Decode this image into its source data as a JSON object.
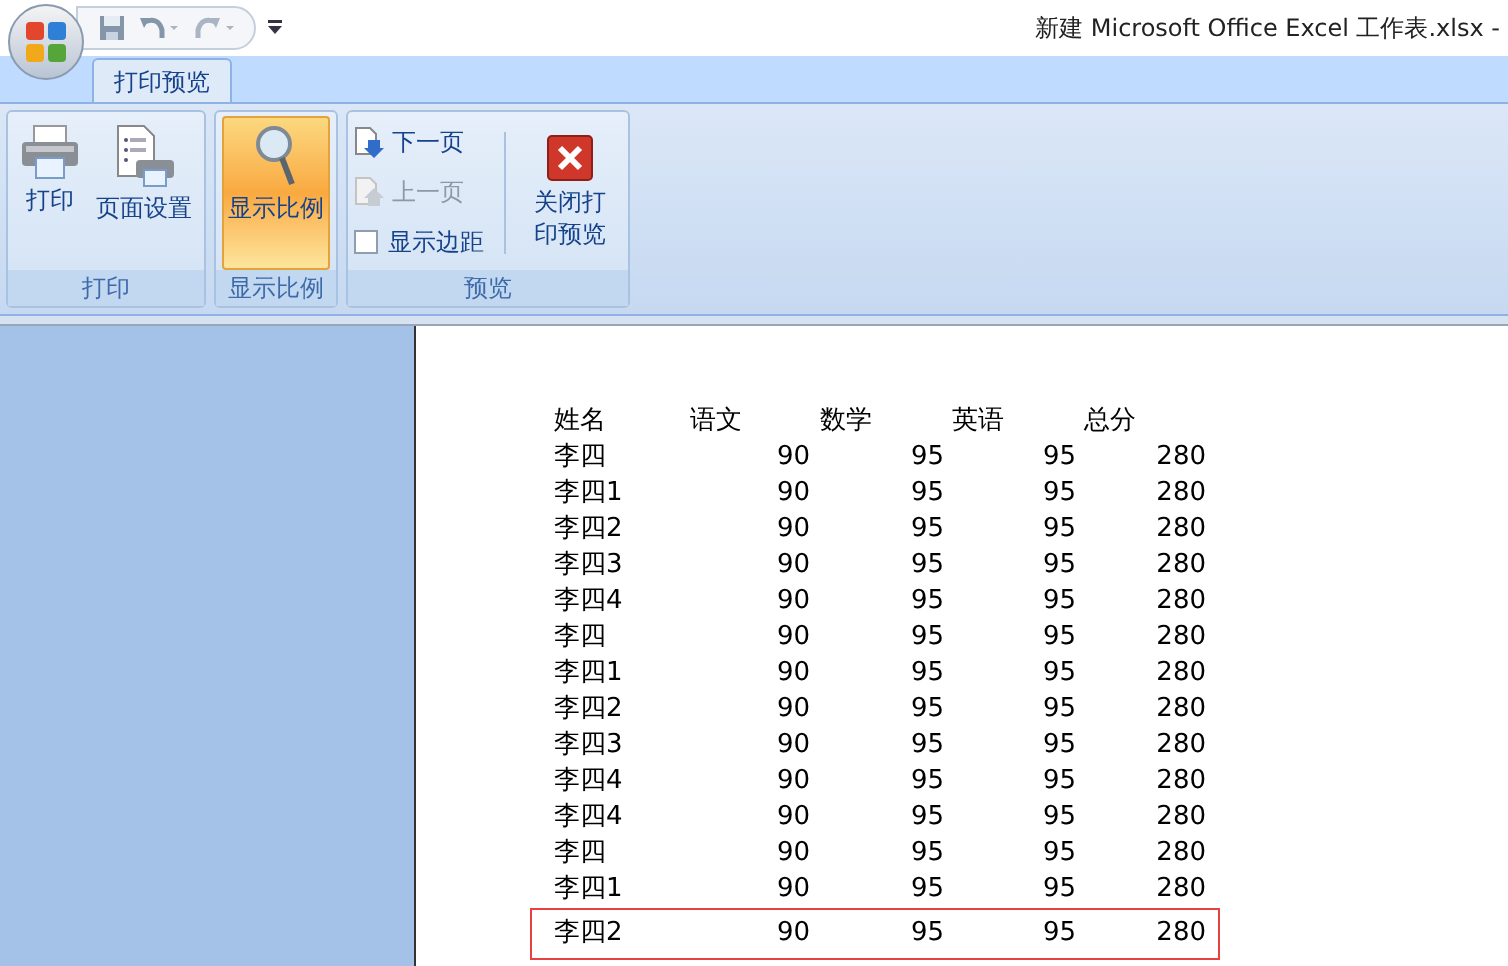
{
  "window": {
    "title": "新建 Microsoft Office Excel 工作表.xlsx -"
  },
  "tabs": [
    {
      "label": "打印预览",
      "selected": true
    }
  ],
  "ribbon": {
    "groups": [
      {
        "label": "打印",
        "items": [
          {
            "kind": "large",
            "label": "打印",
            "selected": false
          },
          {
            "kind": "large",
            "label": "页面设置",
            "selected": false
          }
        ]
      },
      {
        "label": "显示比例",
        "items": [
          {
            "kind": "large",
            "label": "显示比例",
            "selected": true
          }
        ]
      },
      {
        "label": "预览",
        "items": [
          {
            "kind": "small",
            "label": "下一页",
            "disabled": false
          },
          {
            "kind": "small",
            "label": "上一页",
            "disabled": true
          },
          {
            "kind": "checkbox",
            "label": "显示边距",
            "checked": false
          },
          {
            "kind": "large",
            "label": "关闭打印预览",
            "selected": false
          }
        ]
      }
    ]
  },
  "sheet": {
    "columns": [
      "姓名",
      "语文",
      "数学",
      "英语",
      "总分"
    ],
    "rows": [
      {
        "cells": [
          "李四",
          "90",
          "95",
          "95",
          "280"
        ],
        "highlighted": false
      },
      {
        "cells": [
          "李四1",
          "90",
          "95",
          "95",
          "280"
        ],
        "highlighted": false
      },
      {
        "cells": [
          "李四2",
          "90",
          "95",
          "95",
          "280"
        ],
        "highlighted": false
      },
      {
        "cells": [
          "李四3",
          "90",
          "95",
          "95",
          "280"
        ],
        "highlighted": false
      },
      {
        "cells": [
          "李四4",
          "90",
          "95",
          "95",
          "280"
        ],
        "highlighted": false
      },
      {
        "cells": [
          "李四",
          "90",
          "95",
          "95",
          "280"
        ],
        "highlighted": false
      },
      {
        "cells": [
          "李四1",
          "90",
          "95",
          "95",
          "280"
        ],
        "highlighted": false
      },
      {
        "cells": [
          "李四2",
          "90",
          "95",
          "95",
          "280"
        ],
        "highlighted": false
      },
      {
        "cells": [
          "李四3",
          "90",
          "95",
          "95",
          "280"
        ],
        "highlighted": false
      },
      {
        "cells": [
          "李四4",
          "90",
          "95",
          "95",
          "280"
        ],
        "highlighted": false
      },
      {
        "cells": [
          "李四4",
          "90",
          "95",
          "95",
          "280"
        ],
        "highlighted": false
      },
      {
        "cells": [
          "李四",
          "90",
          "95",
          "95",
          "280"
        ],
        "highlighted": false
      },
      {
        "cells": [
          "李四1",
          "90",
          "95",
          "95",
          "280"
        ],
        "highlighted": false
      },
      {
        "cells": [
          "李四2",
          "90",
          "95",
          "95",
          "280"
        ],
        "highlighted": true
      }
    ]
  }
}
